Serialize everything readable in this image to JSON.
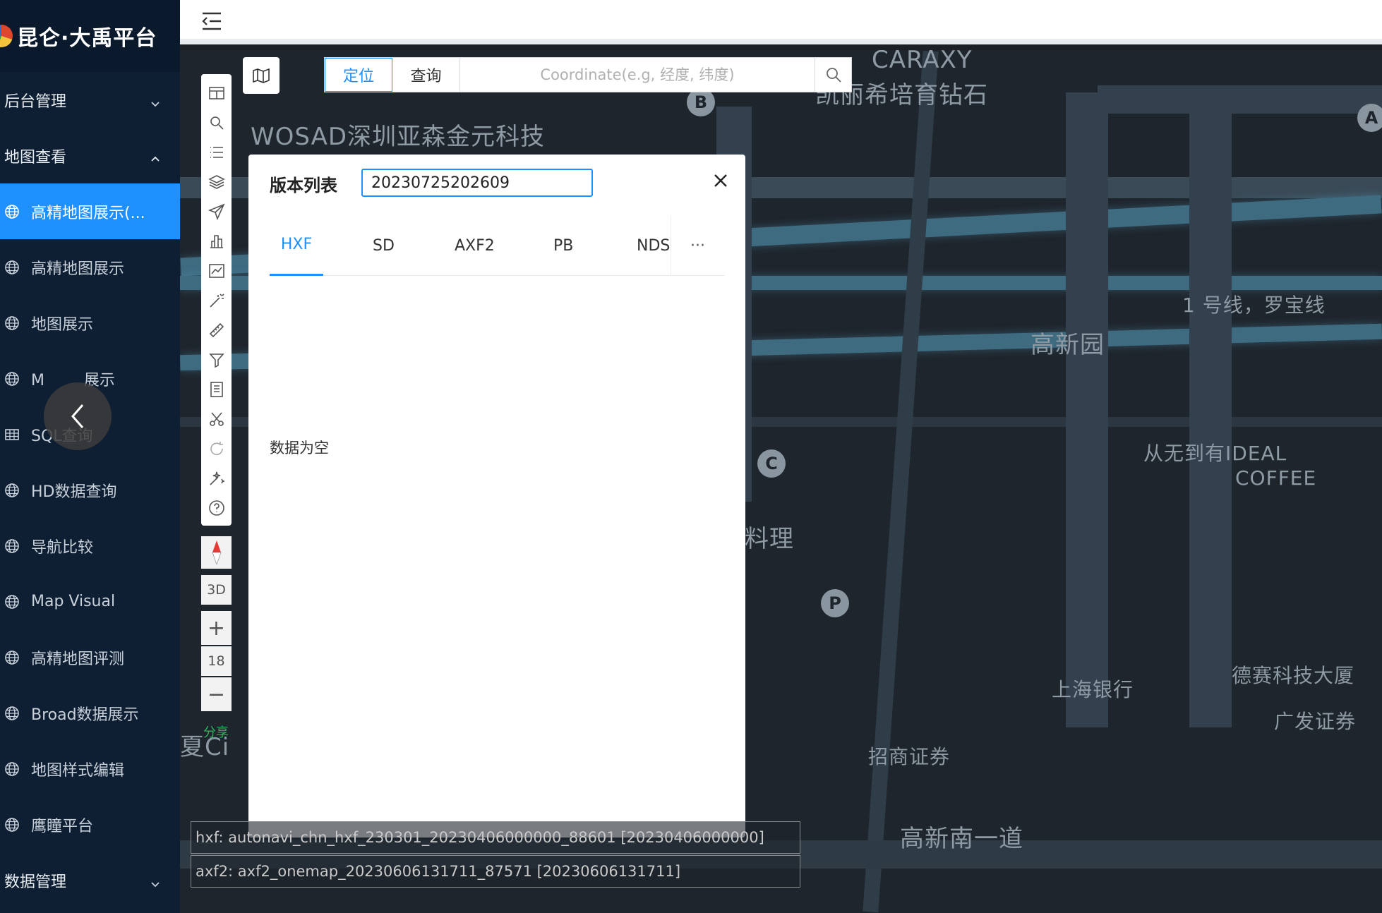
{
  "app": {
    "title": "昆仑·大禹平台"
  },
  "sidebar": {
    "groups": [
      {
        "label": "后台管理",
        "expanded": false
      },
      {
        "label": "地图查看",
        "expanded": true
      },
      {
        "label": "数据管理",
        "expanded": false
      }
    ],
    "items": [
      {
        "label": "高精地图展示(...",
        "icon": "globe-icon",
        "active": true
      },
      {
        "label": "高精地图展示",
        "icon": "globe-icon"
      },
      {
        "label": "地图展示",
        "icon": "globe-icon"
      },
      {
        "label": "M        展示",
        "icon": "globe-icon"
      },
      {
        "label": "SQL查询",
        "icon": "table-icon"
      },
      {
        "label": "HD数据查询",
        "icon": "globe-icon"
      },
      {
        "label": "导航比较",
        "icon": "globe-icon"
      },
      {
        "label": "Map Visual",
        "icon": "globe-icon"
      },
      {
        "label": "高精地图评测",
        "icon": "globe-icon"
      },
      {
        "label": "Broad数据展示",
        "icon": "globe-icon"
      },
      {
        "label": "地图样式编辑",
        "icon": "globe-icon"
      },
      {
        "label": "鹰瞳平台",
        "icon": "globe-icon"
      }
    ]
  },
  "search": {
    "tab_locate": "定位",
    "tab_query": "查询",
    "placeholder": "Coordinate(e.g, 经度, 纬度)"
  },
  "map_controls": {
    "mode_3d": "3D",
    "zoom_level": "18",
    "share": "分享"
  },
  "map_labels": {
    "l1": "CARAXY",
    "l2": "凯丽希培育钻石",
    "l3": "WOSAD深圳亚森金元科技",
    "l4": "1 号线，罗宝线",
    "l5": "高新园",
    "l6": "从无到有IDEAL",
    "l7": "COFFEE",
    "l8": "料理",
    "l9": "上海银行",
    "l10": "德赛科技大厦",
    "l11": "广发证券",
    "l12": "招商证券",
    "l13": "高新南一道",
    "l14": "夏Ci",
    "poi_b": "B",
    "poi_a": "A",
    "poi_c": "C",
    "poi_p": "P"
  },
  "modal": {
    "title": "版本列表",
    "version_value": "20230725202609",
    "tabs": [
      "HXF",
      "SD",
      "AXF2",
      "PB",
      "NDS"
    ],
    "active_tab": "HXF",
    "more": "···",
    "empty_text": "数据为空"
  },
  "info_lines": [
    "hxf: autonavi_chn_hxf_230301_20230406000000_88601 [20230406000000]",
    "axf2: axf2_onemap_20230606131711_87571 [20230606131711]"
  ]
}
